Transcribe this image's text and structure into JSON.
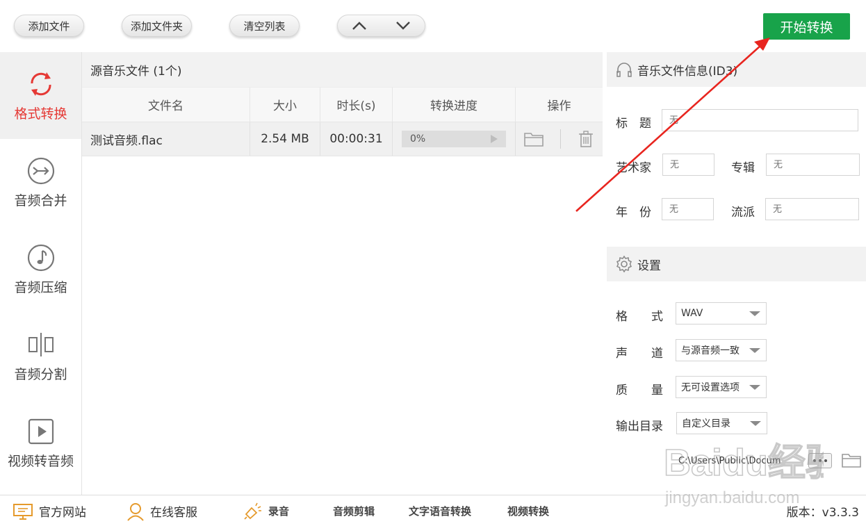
{
  "toolbar": {
    "add_file": "添加文件",
    "add_folder": "添加文件夹",
    "clear_list": "清空列表",
    "start": "开始转换",
    "accent_color": "#18a34a"
  },
  "sidebar": {
    "items": [
      {
        "label": "格式转换",
        "icon": "refresh-icon",
        "active": true
      },
      {
        "label": "音频合并",
        "icon": "merge-icon",
        "active": false
      },
      {
        "label": "音频压缩",
        "icon": "music-note-icon",
        "active": false
      },
      {
        "label": "音频分割",
        "icon": "split-icon",
        "active": false
      },
      {
        "label": "视频转音频",
        "icon": "play-icon",
        "active": false
      }
    ],
    "active_color": "#e53935"
  },
  "files": {
    "header": "源音乐文件 (1个)",
    "columns": [
      "文件名",
      "大小",
      "时长(s)",
      "转换进度",
      "操作"
    ],
    "rows": [
      {
        "name": "测试音频.flac",
        "size": "2.54 MB",
        "duration": "00:00:31",
        "progress": "0%"
      }
    ]
  },
  "info": {
    "header": "音乐文件信息(ID3)",
    "title_label": "标　题",
    "title_placeholder": "无",
    "artist_label": "艺术家",
    "artist_placeholder": "无",
    "album_label": "专辑",
    "album_placeholder": "无",
    "year_label": "年　份",
    "year_placeholder": "无",
    "genre_label": "流派",
    "genre_placeholder": "无"
  },
  "settings": {
    "header": "设置",
    "format_label": "格　　式",
    "format_value": "WAV",
    "channel_label": "声　　道",
    "channel_value": "与源音频一致",
    "quality_label": "质　　量",
    "quality_value": "无可设置选项",
    "output_label": "输出目录",
    "output_value": "自定义目录",
    "output_path": "C:\\Users\\Public\\Docum"
  },
  "bottom": {
    "website": "官方网站",
    "support": "在线客服",
    "record": "录音",
    "audio_edit": "音频剪辑",
    "tts": "文字语音转换",
    "video_convert": "视频转换",
    "version": "版本：v3.3.3"
  },
  "watermark": {
    "text": "Baidu经验",
    "url": "jingyan.baidu.com"
  }
}
